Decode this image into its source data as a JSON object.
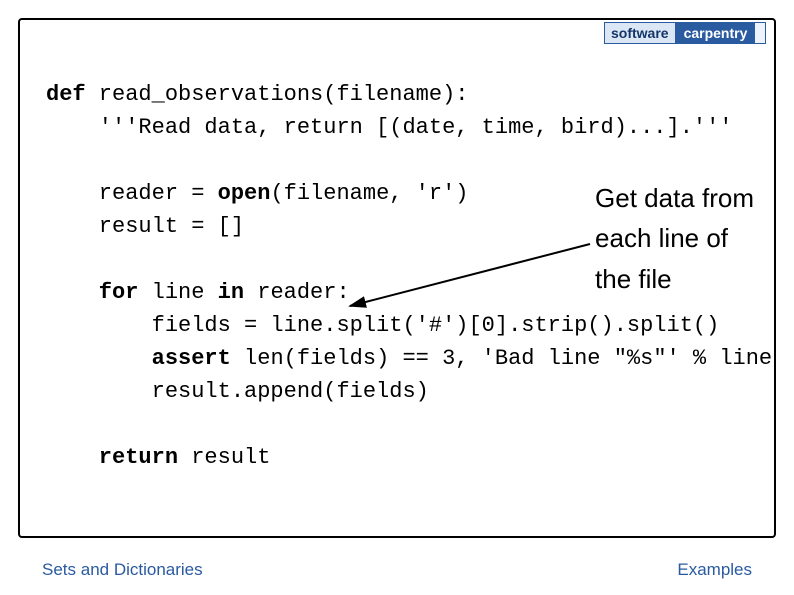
{
  "logo": {
    "left": "software",
    "right": "carpentry"
  },
  "code": {
    "l1a": "def",
    "l1b": " read_observations(filename):",
    "l2": "    '''Read data, return [(date, time, bird)...].'''",
    "l3a": "    reader = ",
    "l3b": "open",
    "l3c": "(filename, 'r')",
    "l4": "    result = []",
    "l5a": "    for",
    "l5b": " line ",
    "l5c": "in",
    "l5d": " reader:",
    "l6": "        fields = line.split('#')[0].strip().split()",
    "l7a": "        assert",
    "l7b": " len(fields) == 3, 'Bad line \"%s\"' % line",
    "l8": "        result.append(fields)",
    "l9a": "    return",
    "l9b": " result"
  },
  "annotation": {
    "l1": "Get data from",
    "l2": "each line of",
    "l3": "the file"
  },
  "footer": {
    "left": "Sets and Dictionaries",
    "right": "Examples"
  }
}
